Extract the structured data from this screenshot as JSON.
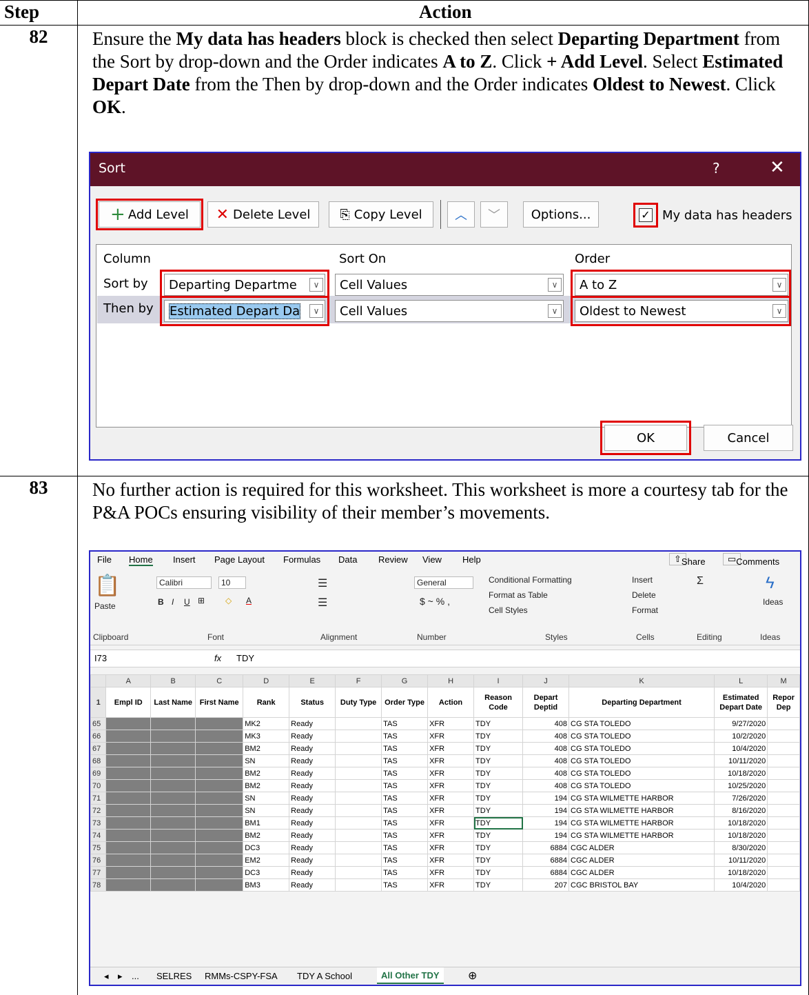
{
  "table": {
    "col_step": "Step",
    "col_action": "Action"
  },
  "step82": {
    "num": "82",
    "p1": "Ensure the ",
    "b1": "My data has headers",
    "p2": " block is checked then select ",
    "b2": "Departing Department",
    "p3": " from the Sort by drop-down and the Order indicates ",
    "b3": "A to Z",
    "p4": ".  Click ",
    "b4": "+ Add Level",
    "p5": ".  Select ",
    "b5": "Estimated Depart Date",
    "p6": " from the Then by drop-down and the Order indicates ",
    "b6": "Oldest to Newest",
    "p7": ".  Click ",
    "b7": "OK",
    "p8": "."
  },
  "sort_dialog": {
    "title": "Sort",
    "help": "?",
    "close": "✕",
    "add_level": "Add Level",
    "delete_level": "Delete Level",
    "copy_level": "Copy Level",
    "options": "Options...",
    "my_data_headers": "My data has headers",
    "col_column": "Column",
    "col_sort_on": "Sort On",
    "col_order": "Order",
    "row1_label": "Sort by",
    "row1_column": "Departing Departme",
    "row1_sort_on": "Cell Values",
    "row1_order": "A to Z",
    "row2_label": "Then by",
    "row2_column": "Estimated Depart Da",
    "row2_sort_on": "Cell Values",
    "row2_order": "Oldest to Newest",
    "ok": "OK",
    "cancel": "Cancel"
  },
  "step83": {
    "num": "83",
    "text": "No further action is required for this worksheet.  This worksheet is more a courtesy tab for the P&A POCs ensuring visibility of their member’s movements."
  },
  "excel": {
    "tabs": [
      "File",
      "Home",
      "Insert",
      "Page Layout",
      "Formulas",
      "Data",
      "Review",
      "View",
      "Help"
    ],
    "share": "Share",
    "comments": "Comments",
    "groups": [
      "Clipboard",
      "Font",
      "Alignment",
      "Number",
      "Styles",
      "Cells",
      "Editing",
      "Ideas"
    ],
    "font_name": "Calibri",
    "font_size": "10",
    "number_format": "General",
    "cond_format": "Conditional Formatting",
    "format_table": "Format as Table",
    "cell_styles": "Cell Styles",
    "insert": "Insert",
    "delete": "Delete",
    "format": "Format",
    "paste": "Paste",
    "ideas": "Ideas",
    "name_box": "I73",
    "fx": "fx",
    "formula_value": "TDY",
    "col_letters": [
      "",
      "A",
      "B",
      "C",
      "D",
      "E",
      "F",
      "G",
      "H",
      "I",
      "J",
      "K",
      "L",
      "M"
    ],
    "headers": [
      "Empl ID",
      "Last Name",
      "First Name",
      "Rank",
      "Status",
      "Duty Type",
      "Order Type",
      "Action",
      "Reason Code",
      "Depart Deptid",
      "Departing Department",
      "Estimated Depart Date",
      "Repor Dep"
    ],
    "rows": [
      [
        "65",
        "MK2",
        "Ready",
        "TAS",
        "XFR",
        "TDY",
        "408",
        "CG STA TOLEDO",
        "9/27/2020"
      ],
      [
        "66",
        "MK3",
        "Ready",
        "TAS",
        "XFR",
        "TDY",
        "408",
        "CG STA TOLEDO",
        "10/2/2020"
      ],
      [
        "67",
        "BM2",
        "Ready",
        "TAS",
        "XFR",
        "TDY",
        "408",
        "CG STA TOLEDO",
        "10/4/2020"
      ],
      [
        "68",
        "SN",
        "Ready",
        "TAS",
        "XFR",
        "TDY",
        "408",
        "CG STA TOLEDO",
        "10/11/2020"
      ],
      [
        "69",
        "BM2",
        "Ready",
        "TAS",
        "XFR",
        "TDY",
        "408",
        "CG STA TOLEDO",
        "10/18/2020"
      ],
      [
        "70",
        "BM2",
        "Ready",
        "TAS",
        "XFR",
        "TDY",
        "408",
        "CG STA TOLEDO",
        "10/25/2020"
      ],
      [
        "71",
        "SN",
        "Ready",
        "TAS",
        "XFR",
        "TDY",
        "194",
        "CG STA WILMETTE HARBOR",
        "7/26/2020"
      ],
      [
        "72",
        "SN",
        "Ready",
        "TAS",
        "XFR",
        "TDY",
        "194",
        "CG STA WILMETTE HARBOR",
        "8/16/2020"
      ],
      [
        "73",
        "BM1",
        "Ready",
        "TAS",
        "XFR",
        "TDY",
        "194",
        "CG STA WILMETTE HARBOR",
        "10/18/2020"
      ],
      [
        "74",
        "BM2",
        "Ready",
        "TAS",
        "XFR",
        "TDY",
        "194",
        "CG STA WILMETTE HARBOR",
        "10/18/2020"
      ],
      [
        "75",
        "DC3",
        "Ready",
        "TAS",
        "XFR",
        "TDY",
        "6884",
        "CGC ALDER",
        "8/30/2020"
      ],
      [
        "76",
        "EM2",
        "Ready",
        "TAS",
        "XFR",
        "TDY",
        "6884",
        "CGC ALDER",
        "10/11/2020"
      ],
      [
        "77",
        "DC3",
        "Ready",
        "TAS",
        "XFR",
        "TDY",
        "6884",
        "CGC ALDER",
        "10/18/2020"
      ],
      [
        "78",
        "BM3",
        "Ready",
        "TAS",
        "XFR",
        "TDY",
        "207",
        "CGC BRISTOL BAY",
        "10/4/2020"
      ]
    ],
    "sheet_tabs": [
      "...",
      "SELRES",
      "RMMs-CSPY-FSA",
      "TDY A School",
      "All Other TDY"
    ]
  }
}
